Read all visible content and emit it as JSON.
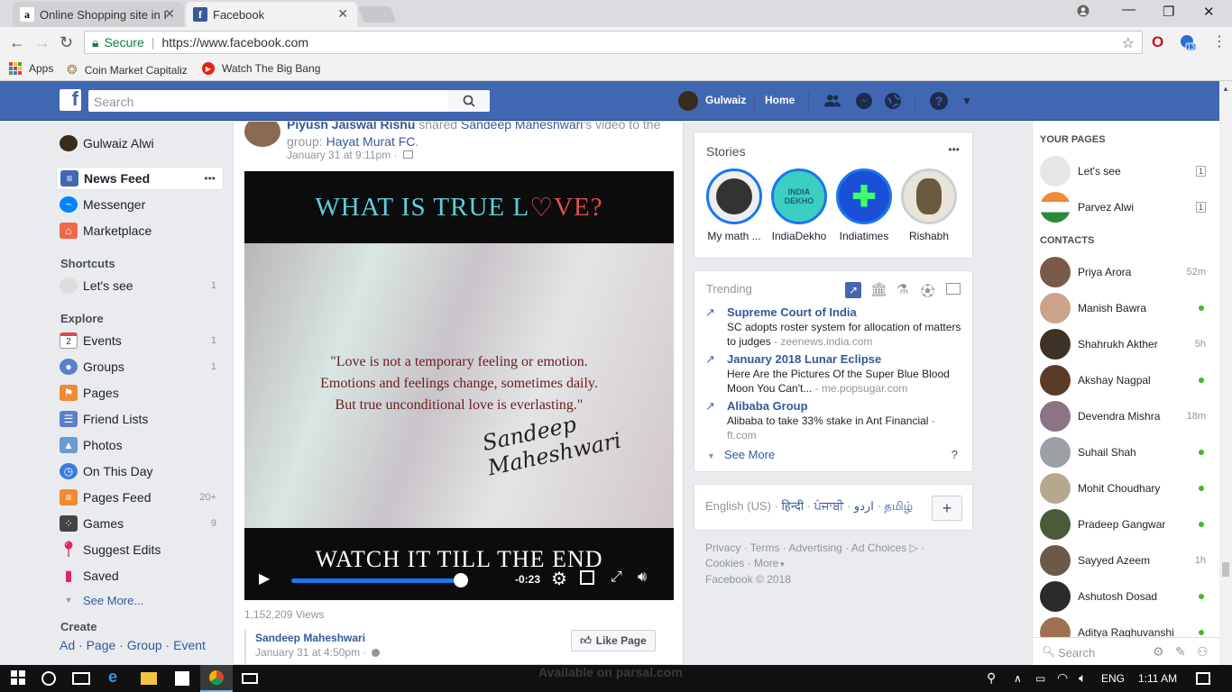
{
  "browser": {
    "tabs": [
      {
        "label": "Online Shopping site in I",
        "icon": "amazon-icon"
      },
      {
        "label": "Facebook",
        "icon": "facebook-icon"
      }
    ],
    "secure_label": "Secure",
    "url": "https://www.facebook.com",
    "bookmarks": [
      "Apps",
      "Coin Market Capitaliz",
      "Watch The Big Bang"
    ],
    "extension_badge": "13"
  },
  "fb": {
    "search_placeholder": "Search",
    "user_name": "Gulwaiz",
    "home": "Home"
  },
  "left": {
    "profile": "Gulwaiz Alwi",
    "news_feed": "News Feed",
    "news_feed_more": "•••",
    "messenger": "Messenger",
    "marketplace": "Marketplace",
    "shortcuts_title": "Shortcuts",
    "shortcut": {
      "label": "Let's see",
      "count": "1"
    },
    "explore_title": "Explore",
    "explore": [
      {
        "label": "Events",
        "count": "1"
      },
      {
        "label": "Groups",
        "count": "1"
      },
      {
        "label": "Pages",
        "count": ""
      },
      {
        "label": "Friend Lists",
        "count": ""
      },
      {
        "label": "Photos",
        "count": ""
      },
      {
        "label": "On This Day",
        "count": ""
      },
      {
        "label": "Pages Feed",
        "count": "20+"
      },
      {
        "label": "Games",
        "count": "9"
      },
      {
        "label": "Suggest Edits",
        "count": ""
      },
      {
        "label": "Saved",
        "count": ""
      }
    ],
    "see_more": "See More...",
    "create_title": "Create",
    "create_links": [
      "Ad",
      "Page",
      "Group",
      "Event"
    ],
    "events_icon_day": "2"
  },
  "post": {
    "author": "Piyush Jaiswal Rishu",
    "shared": "shared",
    "original": "Sandeep Maheshwari",
    "video_word": "'s video to",
    "group_prefix": "the group:",
    "group": "Hayat Murat FC",
    "time": "January 31 at 9:11pm ·",
    "video_title_a": "WHAT IS TRUE L",
    "video_title_heart": "♡",
    "video_title_b": "VE?",
    "quote_l1": "\"Love is not a temporary feeling or emotion.",
    "quote_l2": "Emotions and feelings change, sometimes daily.",
    "quote_l3": "But true unconditional love is everlasting.\"",
    "signature": "Sandeep Maheshwari",
    "bottom_text": "WATCH IT TILL THE END",
    "time_left": "-0:23",
    "progress": 0.88,
    "views": "1,152,209 Views",
    "page_name": "Sandeep Maheshwari",
    "page_time": "January 31 at 4:50pm ·",
    "like_page": "Like Page"
  },
  "stories": {
    "title": "Stories",
    "more": "•••",
    "items": [
      "My math ...",
      "IndiaDekho",
      "Indiatimes",
      "Rishabh"
    ],
    "indiadekho_logo": "INDIA DEKHO"
  },
  "trending": {
    "title": "Trending",
    "items": [
      {
        "title": "Supreme Court of India",
        "desc": "SC adopts roster system for allocation of matters to judges",
        "source": "- zeenews.india.com"
      },
      {
        "title": "January 2018 Lunar Eclipse",
        "desc": "Here Are the Pictures Of the Super Blue Blood Moon You Can't...",
        "source": "- me.popsugar.com"
      },
      {
        "title": "Alibaba Group",
        "desc": "Alibaba to take 33% stake in Ant Financial",
        "source": "- ft.com"
      }
    ],
    "see_more": "See More",
    "help": "?"
  },
  "languages": {
    "current": "English (US) ·",
    "others": [
      "हिन्दी",
      "ਪੰਜਾਬੀ",
      "اردو",
      "தமிழ்"
    ],
    "plus": "+"
  },
  "footer": {
    "line1": [
      "Privacy",
      "Terms",
      "Advertising",
      "Ad Choices"
    ],
    "line2": [
      "Cookies",
      "More"
    ],
    "copyright": "Facebook © 2018"
  },
  "chat": {
    "pages_title": "YOUR PAGES",
    "pages": [
      {
        "name": "Let's see",
        "badge": "1"
      },
      {
        "name": "Parvez Alwi",
        "badge": "1"
      }
    ],
    "contacts_title": "CONTACTS",
    "contacts": [
      {
        "name": "Priya Arora",
        "status": "52m"
      },
      {
        "name": "Manish Bawra",
        "status": "online"
      },
      {
        "name": "Shahrukh Akther",
        "status": "5h"
      },
      {
        "name": "Akshay Nagpal",
        "status": "online"
      },
      {
        "name": "Devendra Mishra",
        "status": "18m"
      },
      {
        "name": "Suhail Shah",
        "status": "online"
      },
      {
        "name": "Mohit Choudhary",
        "status": "online"
      },
      {
        "name": "Pradeep Gangwar",
        "status": "online"
      },
      {
        "name": "Sayyed Azeem",
        "status": "1h"
      },
      {
        "name": "Ashutosh Dosad",
        "status": "online"
      },
      {
        "name": "Aditya Raghuvanshi",
        "status": "online"
      }
    ],
    "search_placeholder": "Search"
  },
  "taskbar": {
    "watermark": "Available on parsal.com",
    "lang": "ENG",
    "time": "1:11 AM"
  },
  "colors": {
    "fb_blue": "#4267b2",
    "link": "#365899",
    "online": "#42b72a"
  }
}
